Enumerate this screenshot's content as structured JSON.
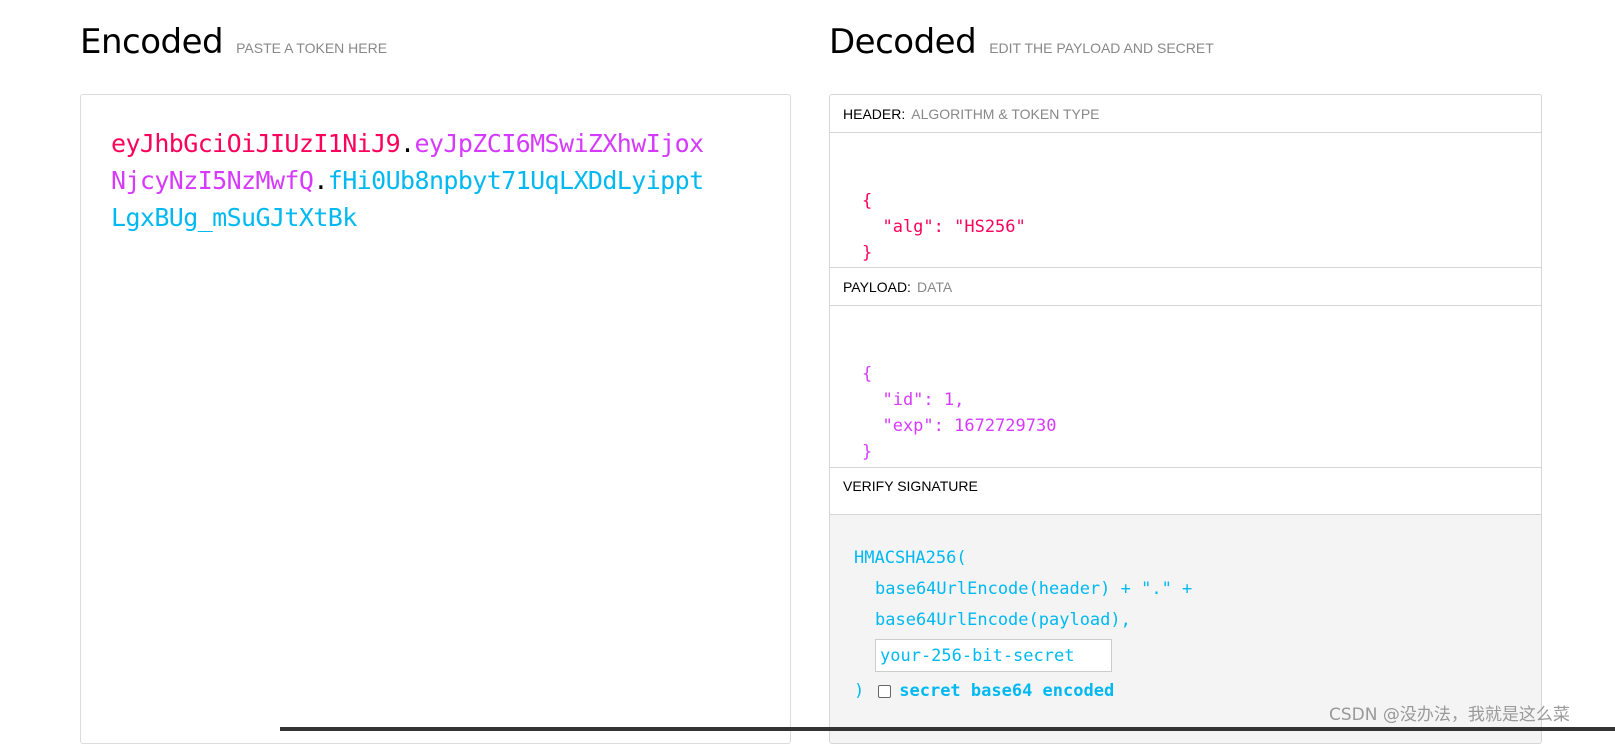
{
  "encoded": {
    "title": "Encoded",
    "subtitle": "PASTE A TOKEN HERE",
    "token_header": "eyJhbGciOiJIUzI1NiJ9",
    "token_payload": "eyJpZCI6MSwiZXhwIjoxNjcyNzI5NzMwfQ",
    "token_signature": "fHi0Ub8npbyt71UqLXDdLyipptLgxBUg_mSuGJtXtBk",
    "dot": "."
  },
  "decoded": {
    "title": "Decoded",
    "subtitle": "EDIT THE PAYLOAD AND SECRET",
    "header": {
      "label": "HEADER:",
      "sublabel": "ALGORITHM & TOKEN TYPE",
      "json_open": "{",
      "json_line1": "  \"alg\": \"HS256\"",
      "json_close": "}"
    },
    "payload": {
      "label": "PAYLOAD:",
      "sublabel": "DATA",
      "json_open": "{",
      "json_line1": "  \"id\": 1,",
      "json_line2": "  \"exp\": 1672729730",
      "json_close": "}"
    },
    "verify": {
      "label": "VERIFY SIGNATURE",
      "line1": "HMACSHA256(",
      "line2": "base64UrlEncode(header) + \".\" +",
      "line3": "base64UrlEncode(payload),",
      "secret_value": "your-256-bit-secret",
      "close_paren": ")",
      "checkbox_label": "secret base64 encoded"
    }
  },
  "watermark": "CSDN @没办法，我就是这么菜",
  "colors": {
    "header": "#fb015b",
    "payload": "#d63aff",
    "signature": "#00b9f1"
  }
}
